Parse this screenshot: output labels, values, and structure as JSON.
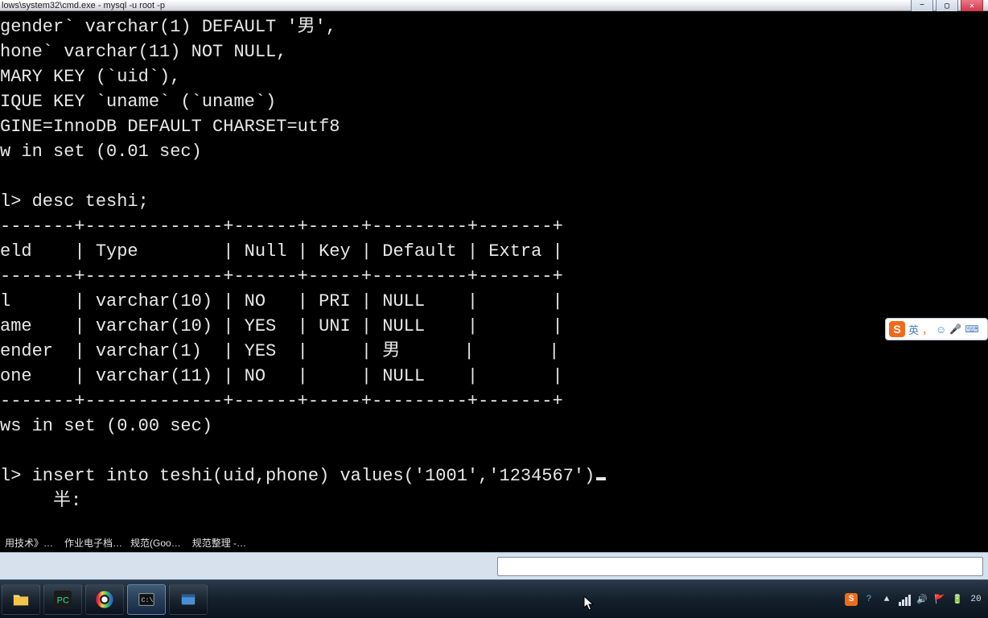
{
  "window": {
    "title": "lows\\system32\\cmd.exe - mysql  -u root -p"
  },
  "terminal": {
    "lines": [
      "gender` varchar(1) DEFAULT '男',",
      "hone` varchar(11) NOT NULL,",
      "MARY KEY (`uid`),",
      "IQUE KEY `uname` (`uname`)",
      "GINE=InnoDB DEFAULT CHARSET=utf8",
      "w in set (0.01 sec)",
      "",
      "l> desc teshi;"
    ],
    "table": {
      "border": "-------+-------------+------+-----+---------+-------+",
      "header": "eld    | Type        | Null | Key | Default | Extra |",
      "rows": [
        "l      | varchar(10) | NO   | PRI | NULL    |       |",
        "ame    | varchar(10) | YES  | UNI | NULL    |       |",
        "ender  | varchar(1)  | YES  |     | 男      |       |",
        "one    | varchar(11) | NO   |     | NULL    |       |"
      ]
    },
    "after_table": [
      "ws in set (0.00 sec)",
      "",
      "l> insert into teshi(uid,phone) values('1001','1234567')",
      "     半:"
    ]
  },
  "browser_tabs": [
    "用技术》…",
    "作业电子档…",
    "规范(Goo…",
    "规范整理 -…"
  ],
  "omnibox": {
    "value": ""
  },
  "ime": {
    "logo": "S",
    "lang": "英",
    "sep": "，",
    "face": "☺",
    "mic": "🎤",
    "kb": "⌨"
  },
  "tray": {
    "s_icon": "S",
    "help": "?",
    "arrow": "▲",
    "vol": "🔊",
    "net": "📶",
    "flag": "🚩",
    "bat": "🔋",
    "clock": "20"
  },
  "task_icons": {
    "explorer": "explorer-icon",
    "pycharm": "pycharm-icon",
    "browser": "browser-icon",
    "cmd": "cmd-icon",
    "app": "card-icon"
  }
}
